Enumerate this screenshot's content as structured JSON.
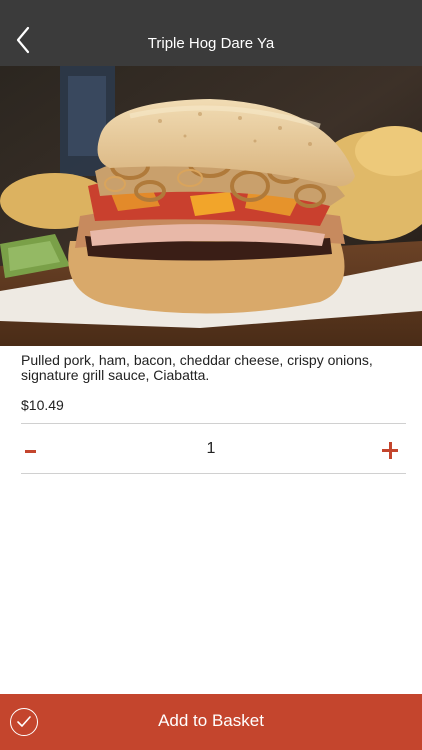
{
  "header": {
    "title": "Triple Hog Dare Ya",
    "back_icon": "chevron-left-icon"
  },
  "product": {
    "description": "Pulled pork, ham, bacon, cheddar cheese, crispy onions, signature grill sauce, Ciabatta.",
    "price": "$10.49"
  },
  "quantity": {
    "value": "1",
    "minus_icon": "minus-icon",
    "plus_icon": "plus-icon"
  },
  "footer": {
    "add_label": "Add to Basket",
    "check_icon": "check-circle-icon"
  },
  "colors": {
    "header_bg": "#3b3b3b",
    "accent": "#c4452d",
    "divider": "#d0d0d0"
  }
}
